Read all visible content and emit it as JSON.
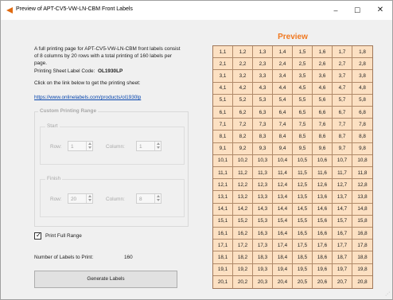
{
  "window": {
    "title": "Preview of APT-CV5-VW-LN-CBM Front Labels",
    "minimize_glyph": "–",
    "maximize_glyph": "☐",
    "close_glyph": "✕",
    "icon": "orange-arrow-icon",
    "accent_color": "#e06a10"
  },
  "left": {
    "description": "A full printing page for APT-CV5-VW-LN-CBM front labels consist of 8 columns by 20 rows with a total printing of 160 labels per page.",
    "code_label": "Printing Sheet Label Code:",
    "code_value": "OL1930LP",
    "click_text": "Click on the link below to get the printing sheet:",
    "link_text": "https://www.onlinelabels.com/products/ol1930lp",
    "custom_range": {
      "title": "Custom Printing Range",
      "start": {
        "title": "Start",
        "row_label": "Row:",
        "row_value": "1",
        "column_label": "Column:",
        "column_value": "1"
      },
      "finish": {
        "title": "Finish",
        "row_label": "Row:",
        "row_value": "20",
        "column_label": "Column:",
        "column_value": "8"
      }
    },
    "print_full_range_label": "Print Full Range",
    "print_full_range_checked": true,
    "check_glyph": "✓",
    "count_label": "Number of Labels to Print:",
    "count_value": "160",
    "generate_button": "Generate Labels"
  },
  "preview": {
    "title": "Preview",
    "title_color": "#f07820",
    "cell_color": "#fce0c2",
    "rows": 20,
    "columns": 8
  }
}
